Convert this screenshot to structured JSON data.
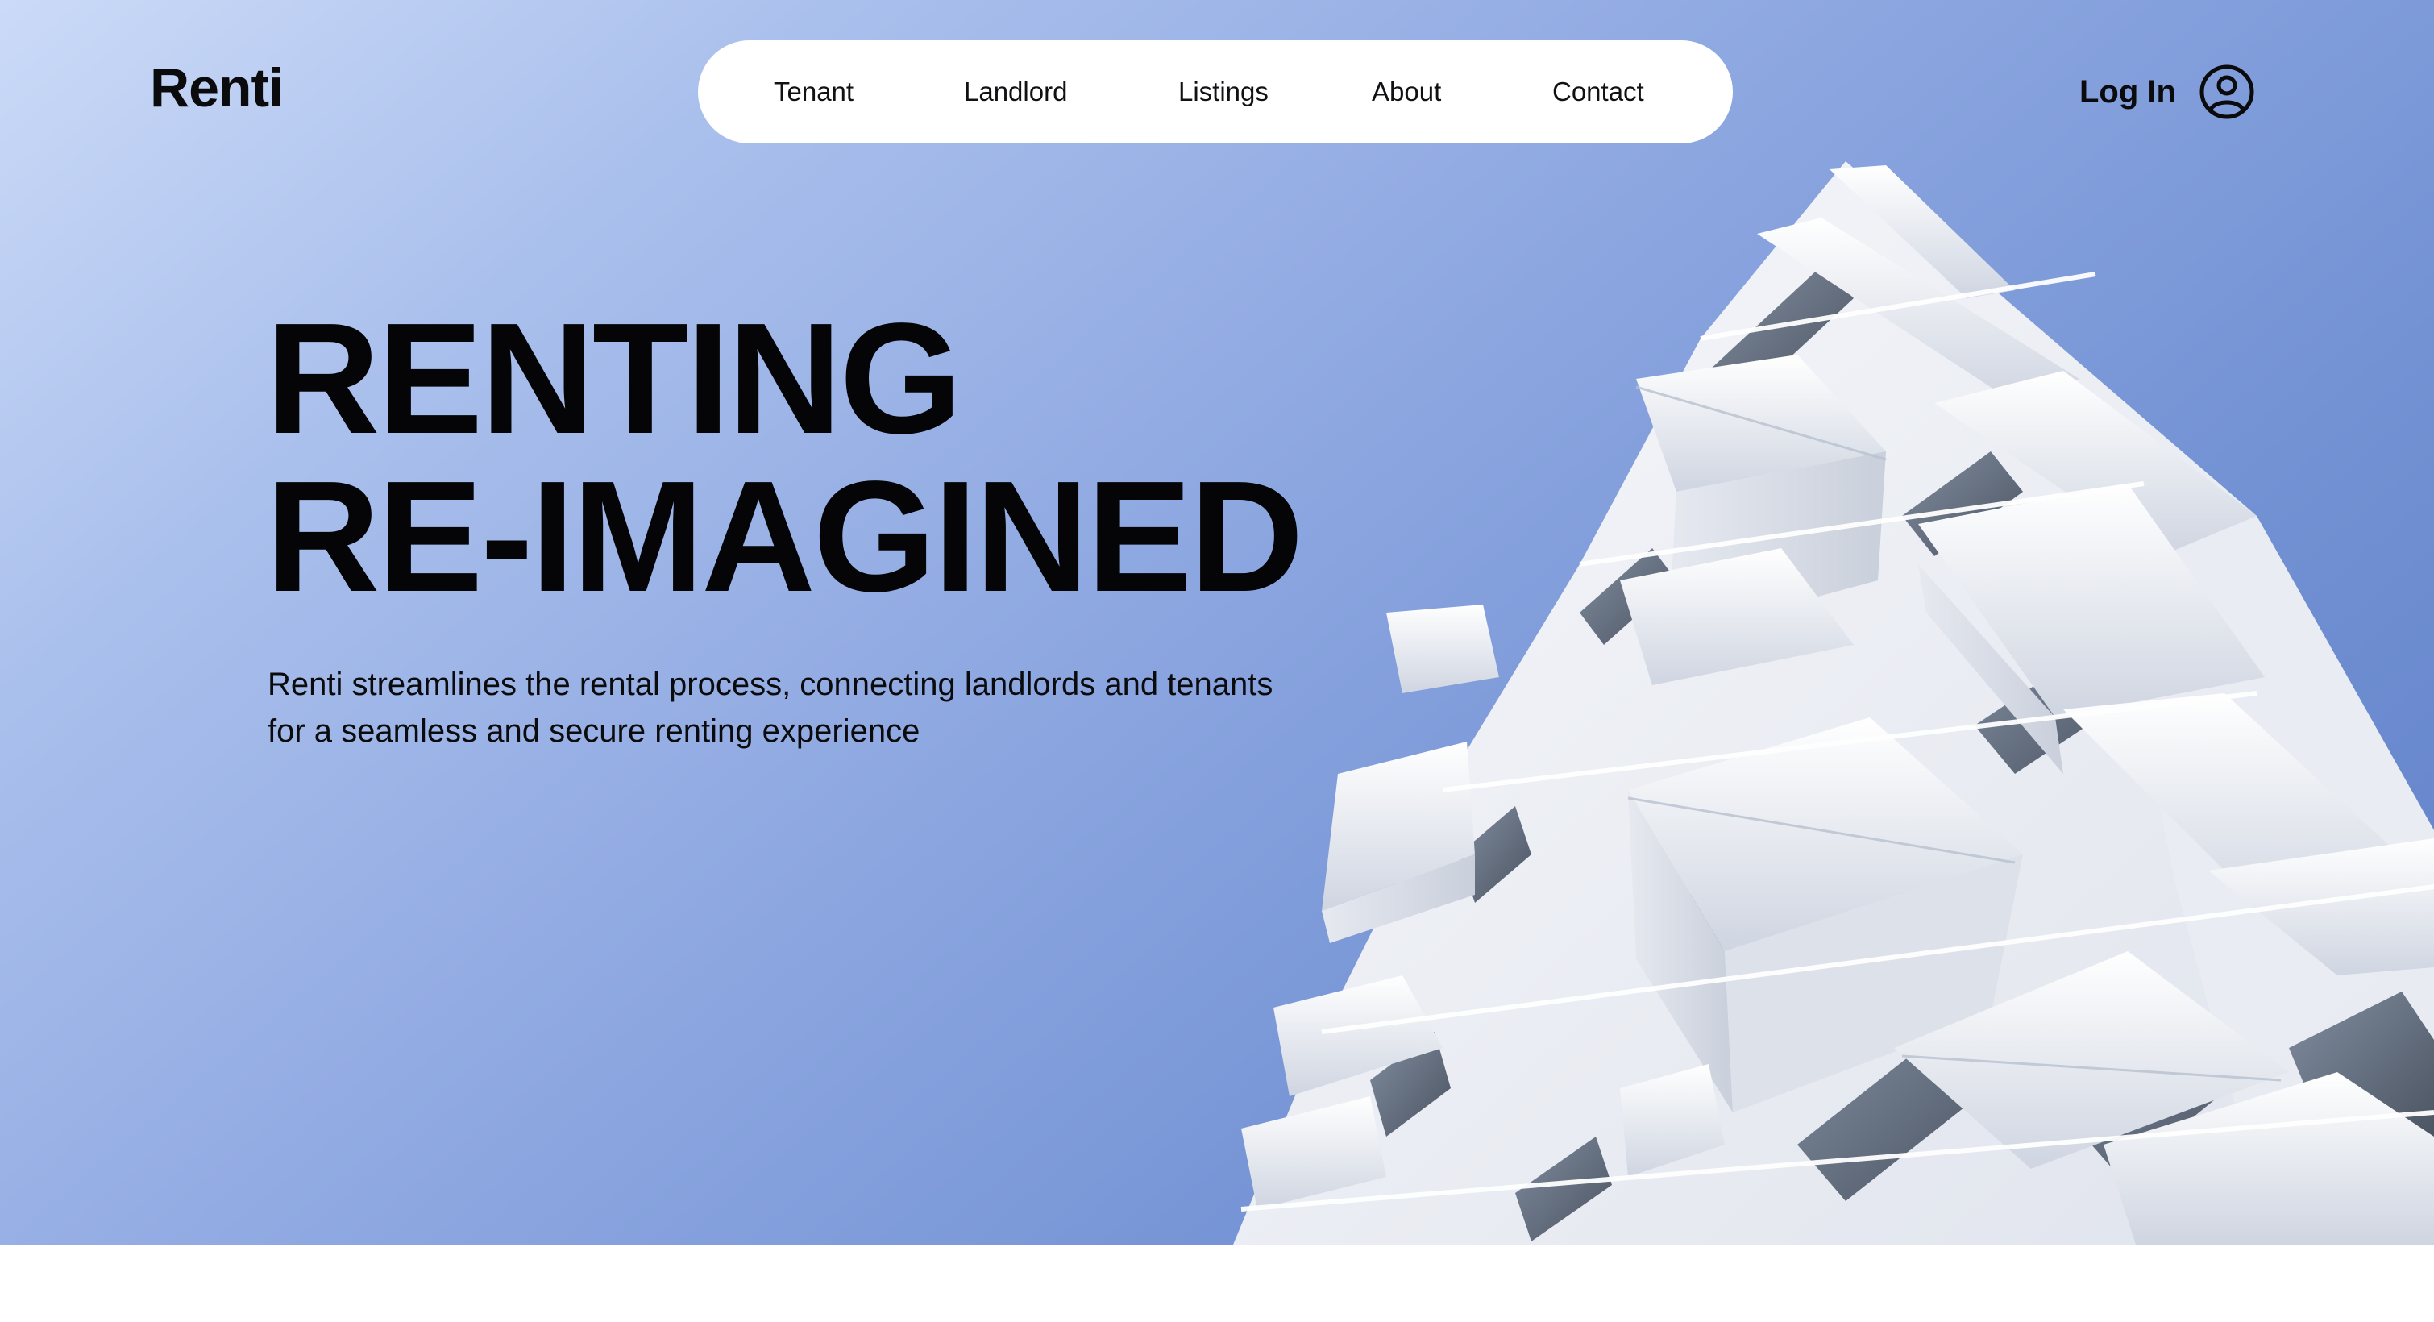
{
  "brand": {
    "name": "Renti"
  },
  "nav": {
    "items": [
      {
        "label": "Tenant"
      },
      {
        "label": "Landlord"
      },
      {
        "label": "Listings"
      },
      {
        "label": "About"
      },
      {
        "label": "Contact"
      }
    ]
  },
  "account": {
    "login_label": "Log In",
    "icon": "user-circle-icon"
  },
  "hero": {
    "headline_line1": "RENTING",
    "headline_line2": "RE-IMAGINED",
    "description_line1": "Renti streamlines the rental process, connecting landlords and tenants",
    "description_line2": "for a seamless and secure renting experience",
    "image": "white-apartment-building-photo"
  },
  "colors": {
    "sky_light": "#cbdaf7",
    "sky_dark": "#5f7fc8",
    "nav_background": "#ffffff",
    "text": "#0b0b0d"
  }
}
